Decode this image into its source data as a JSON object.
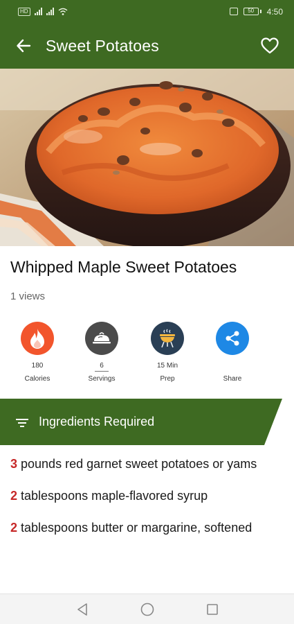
{
  "status_bar": {
    "sim_label": "HD",
    "time": "4:50",
    "battery": "50"
  },
  "app_bar": {
    "title": "Sweet Potatoes",
    "back_icon": "arrow-left-icon",
    "favorite_icon": "heart-outline-icon"
  },
  "recipe": {
    "image_alt": "Bowl of whipped maple sweet potatoes topped with pecans",
    "title": "Whipped Maple Sweet Potatoes",
    "views": "1 views"
  },
  "stats": [
    {
      "value": "180",
      "label": "Calories",
      "icon": "flame-icon",
      "color": "#f2552c"
    },
    {
      "value": "6",
      "label": "Servings",
      "icon": "serving-dish-icon",
      "color": "#4b4b4b"
    },
    {
      "value": "15 Min",
      "label": "Prep",
      "icon": "grill-icon",
      "color": "#2a3f55"
    },
    {
      "value": "",
      "label": "Share",
      "icon": "share-icon",
      "color": "#1e88e5"
    }
  ],
  "section": {
    "title": "Ingredients Required",
    "icon": "filter-list-icon"
  },
  "ingredients": [
    {
      "qty": "3",
      "text": " pounds red garnet sweet potatoes or yams"
    },
    {
      "qty": "2",
      "text": " tablespoons maple-flavored syrup"
    },
    {
      "qty": "2",
      "text": " tablespoons butter or margarine, softened"
    }
  ],
  "colors": {
    "primary": "#3e6a22",
    "quantity": "#c62828"
  }
}
